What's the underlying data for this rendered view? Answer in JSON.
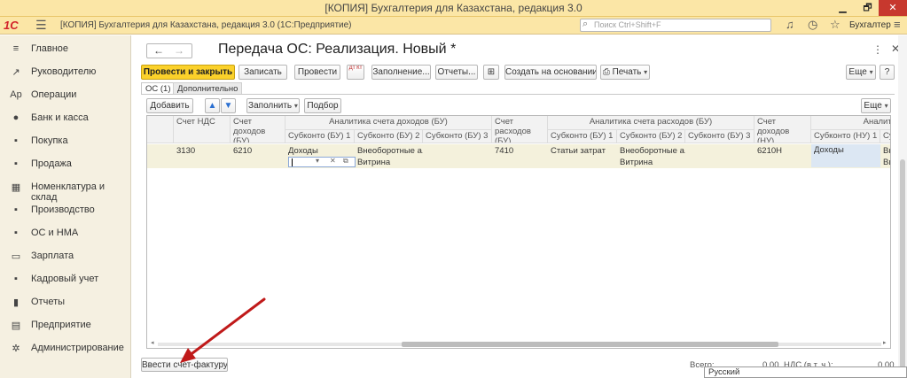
{
  "window": {
    "title": "[КОПИЯ] Бухгалтерия для Казахстана, редакция 3.0",
    "min": "▁",
    "max": "🗗",
    "close": "✕"
  },
  "app": {
    "logo": "1С",
    "caption": "[КОПИЯ] Бухгалтерия для Казахстана, редакция 3.0  (1С:Предприятие)",
    "search_placeholder": "Поиск Ctrl+Shift+F",
    "user": "Бухгалтер"
  },
  "sidebar": {
    "items": [
      {
        "label": "Главное",
        "icon": "≡"
      },
      {
        "label": "Руководителю",
        "icon": "↗"
      },
      {
        "label": "Операции",
        "icon": "Ар"
      },
      {
        "label": "Банк и касса",
        "icon": "●"
      },
      {
        "label": "Покупка",
        "icon": "▪"
      },
      {
        "label": "Продажа",
        "icon": "▪"
      },
      {
        "label": "Номенклатура и склад",
        "icon": "▦"
      },
      {
        "label": "Производство",
        "icon": "▪"
      },
      {
        "label": "ОС и НМА",
        "icon": "▪"
      },
      {
        "label": "Зарплата",
        "icon": "▭"
      },
      {
        "label": "Кадровый учет",
        "icon": "▪"
      },
      {
        "label": "Отчеты",
        "icon": "▮"
      },
      {
        "label": "Предприятие",
        "icon": "▤"
      },
      {
        "label": "Администрирование",
        "icon": "✲"
      }
    ]
  },
  "form": {
    "title": "Передача ОС: Реализация. Новый *",
    "more": "⋮",
    "close": "✕",
    "back": "←",
    "forward": "→"
  },
  "toolbar": {
    "post_close": "Провести и закрыть",
    "save": "Записать",
    "post": "Провести",
    "dtkt": "Дт Кт",
    "fill": "Заполнение...",
    "reports": "Отчеты...",
    "create_based": "Создать на основании",
    "print": "Печать",
    "more": "Еще",
    "help": "?"
  },
  "tabs": [
    {
      "label": "ОС (1)"
    },
    {
      "label": "Дополнительно"
    }
  ],
  "table_toolbar": {
    "add": "Добавить",
    "up": "▲",
    "down": "▼",
    "fill": "Заполнить",
    "select": "Подбор",
    "more": "Еще"
  },
  "table": {
    "headers": {
      "vat_account": "Счет НДС",
      "income_account_bu": "Счет доходов (БУ)",
      "income_analytics_bu": "Аналитика счета доходов (БУ)",
      "subkonto_bu1": "Субконто (БУ) 1",
      "subkonto_bu2": "Субконто (БУ) 2",
      "subkonto_bu3": "Субконто (БУ) 3",
      "expense_account_bu": "Счет расходов (БУ)",
      "expense_analytics_bu": "Аналитика счета расходов (БУ)",
      "exp_subkonto_bu1": "Субконто (БУ) 1",
      "exp_subkonto_bu2": "Субконто (БУ) 2",
      "exp_subkonto_bu3": "Субконто (БУ) 3",
      "income_account_nu": "Счет доходов (НУ)",
      "income_analytics_nu": "Аналити",
      "subkonto_nu1": "Субконто (НУ) 1",
      "subkonto_nu2": "Су"
    },
    "row": {
      "vat_account": "3130",
      "income_account_bu": "6210",
      "subkonto_bu1": "Доходы",
      "subkonto_bu2": "Внеоборотные а...",
      "subkonto_bu2_line2": "Витрина",
      "expense_account_bu": "7410",
      "exp_subkonto_bu1": "Статьи затрат",
      "exp_subkonto_bu2": "Внеоборотные а...",
      "exp_subkonto_bu2_line2": "Витрина",
      "income_account_nu": "6210Н",
      "subkonto_nu1": "Доходы",
      "subkonto_nu2": "Вн",
      "subkonto_nu2_line2": "Ви"
    }
  },
  "footer": {
    "invoice_button": "Ввести счет-фактуру",
    "total_label": "Всего:",
    "total_value": "0,00",
    "vat_label": "НДС (в т. ч.):",
    "vat_value": "0,00",
    "language": "Русский"
  },
  "colors": {
    "header_bg": "#fbe6a6",
    "primary_button": "#fbd12a",
    "row_highlight": "#f4f1dc",
    "annotation_arrow": "#c01a1a"
  }
}
